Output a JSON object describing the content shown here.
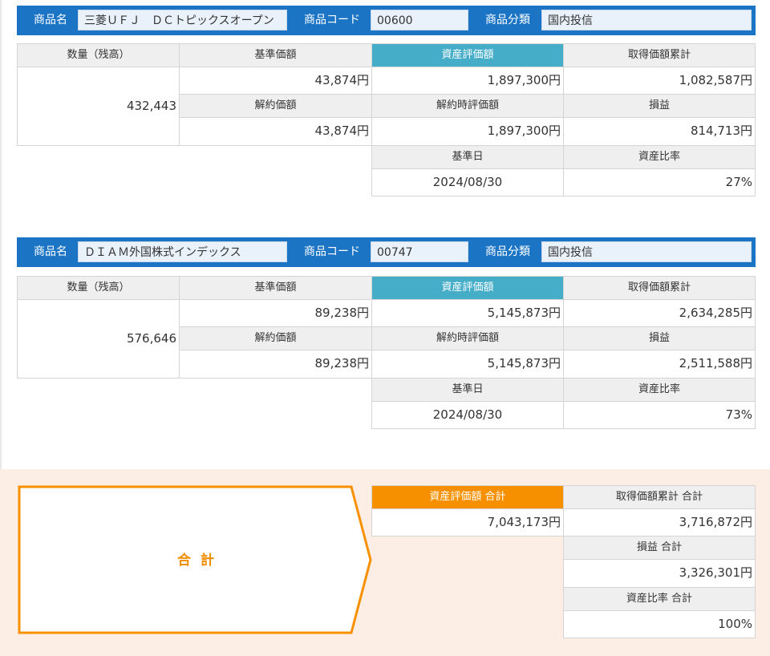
{
  "labels": {
    "product_name": "商品名",
    "product_code": "商品コード",
    "product_category": "商品分類",
    "quantity": "数量（残高）",
    "base_price": "基準価額",
    "asset_valuation": "資産評価額",
    "acquisition_total": "取得価額累計",
    "cancel_price": "解約価額",
    "cancel_valuation": "解約時評価額",
    "profit_loss": "損益",
    "base_date": "基準日",
    "asset_ratio": "資産比率"
  },
  "products": [
    {
      "name": "三菱ＵＦＪ　ＤＣトピックスオープン",
      "code": "00600",
      "category": "国内投信",
      "quantity": "432,443",
      "base_price": "43,874円",
      "asset_valuation": "1,897,300円",
      "acquisition_total": "1,082,587円",
      "cancel_price": "43,874円",
      "cancel_valuation": "1,897,300円",
      "profit_loss": "814,713円",
      "base_date": "2024/08/30",
      "asset_ratio": "27%"
    },
    {
      "name": "ＤＩＡＭ外国株式インデックス",
      "code": "00747",
      "category": "国内投信",
      "quantity": "576,646",
      "base_price": "89,238円",
      "asset_valuation": "5,145,873円",
      "acquisition_total": "2,634,285円",
      "cancel_price": "89,238円",
      "cancel_valuation": "5,145,873円",
      "profit_loss": "2,511,588円",
      "base_date": "2024/08/30",
      "asset_ratio": "73%"
    }
  ],
  "totals": {
    "title": "合 計",
    "asset_valuation_label": "資産評価額 合計",
    "asset_valuation": "7,043,173円",
    "acquisition_total_label": "取得価額累計 合計",
    "acquisition_total": "3,716,872円",
    "profit_loss_label": "損益 合計",
    "profit_loss": "3,326,301円",
    "asset_ratio_label": "資産比率 合計",
    "asset_ratio": "100%"
  },
  "colors": {
    "header_blue": "#1b75c4",
    "accent_teal": "#45adc8",
    "total_orange": "#f79000",
    "total_bg": "#fdeee5"
  }
}
